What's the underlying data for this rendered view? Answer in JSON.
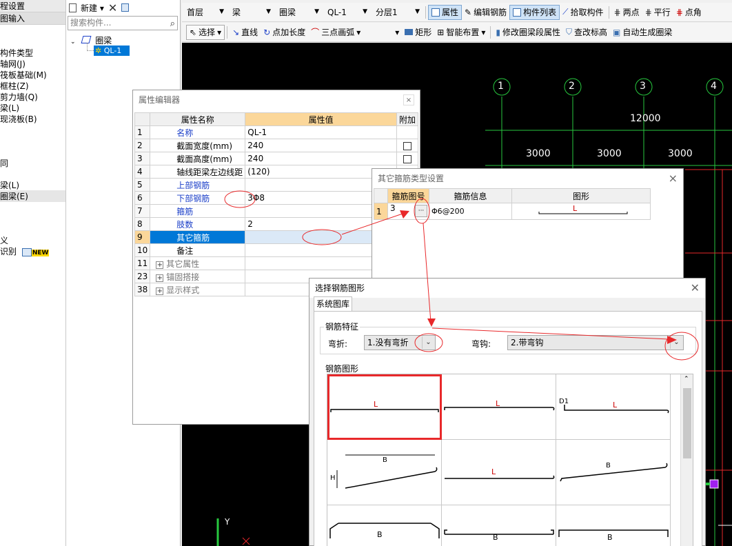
{
  "leftnav": {
    "header1": "程设置",
    "header2": "图输入",
    "items": [
      "构件类型",
      "轴网(J)",
      "筏板基础(M)",
      "框柱(Z)",
      "剪力墙(Q)",
      "梁(L)",
      "现浇板(B)",
      "",
      "",
      "同",
      "",
      "梁(L)",
      "圈梁(E)",
      "",
      "",
      "义",
      "识别"
    ],
    "new_badge": "NEW"
  },
  "tree": {
    "new_label": "新建",
    "search_placeholder": "搜索构件...",
    "root_label": "圈梁",
    "child_label": "QL-1"
  },
  "toolbar1": {
    "floor": "首层",
    "type": "梁",
    "subtype": "圈梁",
    "member": "QL-1",
    "layer": "分层1",
    "attr_label": "属性",
    "edit_rebar_label": "编辑钢筋",
    "member_list_label": "构件列表",
    "pick_label": "拾取构件",
    "two_point_label": "两点",
    "parallel_label": "平行",
    "point_angle_label": "点角"
  },
  "toolbar2": {
    "select_label": "选择",
    "line_label": "直线",
    "point_length_label": "点加长度",
    "arc_label": "三点画弧",
    "rect_label": "矩形",
    "smart_label": "智能布置",
    "modify_attr_label": "修改圈梁段属性",
    "elev_label": "查改标高",
    "auto_gen_label": "自动生成圈梁"
  },
  "canvas": {
    "axes": [
      "1",
      "2",
      "3",
      "4"
    ],
    "total_dim": "12000",
    "spans": [
      "3000",
      "3000",
      "3000"
    ],
    "ucs_y": "Y"
  },
  "prop_editor": {
    "title": "属性编辑器",
    "col_name": "属性名称",
    "col_value": "属性值",
    "col_extra": "附加",
    "rows": [
      {
        "num": "1",
        "name": "名称",
        "value": "QL-1",
        "blue": true,
        "check": false
      },
      {
        "num": "2",
        "name": "截面宽度(mm)",
        "value": "240",
        "blue": false,
        "check": true
      },
      {
        "num": "3",
        "name": "截面高度(mm)",
        "value": "240",
        "blue": false,
        "check": true
      },
      {
        "num": "4",
        "name": "轴线距梁左边线距",
        "value": "(120)",
        "blue": false,
        "check": false
      },
      {
        "num": "5",
        "name": "上部钢筋",
        "value": "",
        "blue": true,
        "check": false
      },
      {
        "num": "6",
        "name": "下部钢筋",
        "value": "3Φ8",
        "blue": true,
        "check": false
      },
      {
        "num": "7",
        "name": "箍筋",
        "value": "",
        "blue": true,
        "check": false
      },
      {
        "num": "8",
        "name": "肢数",
        "value": "2",
        "blue": true,
        "check": false
      },
      {
        "num": "9",
        "name": "其它箍筋",
        "value": "",
        "blue": false,
        "check": false
      },
      {
        "num": "10",
        "name": "备注",
        "value": "",
        "blue": false,
        "check": false
      },
      {
        "num": "11",
        "name": "其它属性",
        "value": "",
        "blue": false,
        "check": false
      },
      {
        "num": "23",
        "name": "锚固搭接",
        "value": "",
        "blue": false,
        "check": false
      },
      {
        "num": "38",
        "name": "显示样式",
        "value": "",
        "blue": false,
        "check": false
      }
    ]
  },
  "stirrup_dialog": {
    "title": "其它箍筋类型设置",
    "col_shape_no": "箍筋图号",
    "col_info": "箍筋信息",
    "col_shape": "图形",
    "row_num": "1",
    "shape_no": "3",
    "ellipsis": "···",
    "info": "Φ6@200",
    "shape_label": "L"
  },
  "shape_dialog": {
    "title": "选择钢筋图形",
    "tab": "系统图库",
    "feature_group": "钢筋特征",
    "bend_label": "弯折:",
    "bend_value": "1.没有弯折",
    "hook_label": "弯钩:",
    "hook_value": "2.带弯钩",
    "shapes_group": "钢筋图形",
    "shape_labels": [
      "L",
      "L",
      "L",
      "B",
      "L",
      "B",
      "B",
      "B",
      "B"
    ],
    "d1_label": "D1",
    "h_label": "H"
  },
  "colors": {
    "annotation_red": "#e8282a",
    "grid_green": "#27c93f",
    "selection_blue": "#0078d7",
    "header_orange": "#fbd79a"
  }
}
